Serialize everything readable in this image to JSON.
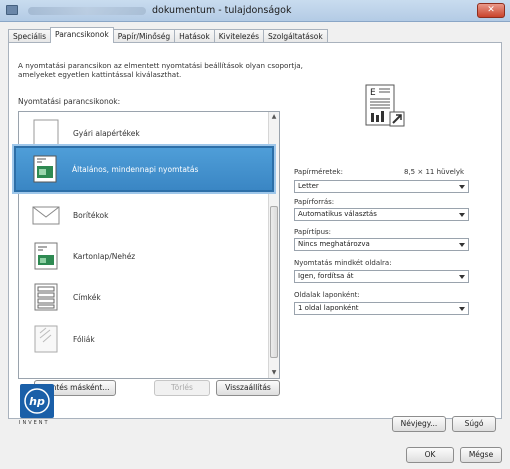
{
  "window": {
    "title": "dokumentum - tulajdonságok",
    "close_label": "✕"
  },
  "tabs": [
    "Speciális",
    "Parancsikonok",
    "Papír/Minőség",
    "Hatások",
    "Kivitelezés",
    "Szolgáltatások"
  ],
  "active_tab": "Parancsikonok",
  "description": "A nyomtatási parancsikon az elmentett nyomtatási beállítások olyan csoportja, amelyeket egyetlen kattintással kiválaszthat.",
  "list_label": "Nyomtatási parancsikonok:",
  "shortcuts": [
    {
      "label": "Gyári alapértékek",
      "icon": "blank-page-icon"
    },
    {
      "label": "Általános, mindennapi nyomtatás",
      "icon": "everyday-print-icon",
      "selected": true
    },
    {
      "label": "Borítékok",
      "icon": "envelope-icon"
    },
    {
      "label": "Kartonlap/Nehéz",
      "icon": "cardstock-icon"
    },
    {
      "label": "Címkék",
      "icon": "labels-icon"
    },
    {
      "label": "Fóliák",
      "icon": "transparency-icon"
    }
  ],
  "buttons": {
    "save_as": "Mentés másként...",
    "delete": "Törlés",
    "reset": "Visszaállítás",
    "about": "Névjegy...",
    "help": "Súgó",
    "ok": "OK",
    "cancel": "Mégse"
  },
  "settings": {
    "paper_size": {
      "label": "Papírméretek:",
      "dimension": "8,5 × 11 hüvelyk",
      "value": "Letter"
    },
    "paper_source": {
      "label": "Papírforrás:",
      "value": "Automatikus választás"
    },
    "paper_type": {
      "label": "Papírtípus:",
      "value": "Nincs meghatározva"
    },
    "duplex": {
      "label": "Nyomtatás mindkét oldalra:",
      "value": "Igen, fordítsa át"
    },
    "pages_per_sheet": {
      "label": "Oldalak laponként:",
      "value": "1 oldal laponként"
    }
  },
  "logo": {
    "text": "hp",
    "tagline": "INVENT"
  },
  "colors": {
    "selection": "#3a86c4",
    "hp_blue": "#1a5fa8"
  }
}
